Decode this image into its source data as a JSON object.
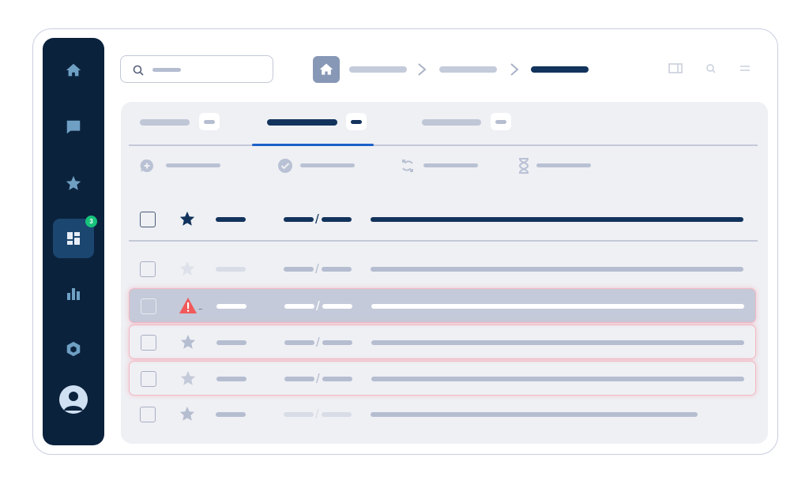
{
  "colors": {
    "sidebar_bg": "#0b223d",
    "nav_active_bg": "#1b4670",
    "nav_icon": "#6fa0c4",
    "badge": "#17c37b",
    "accent_tab": "#1b60c9",
    "dark_text": "#12335c",
    "muted_bar": "#b5bdd0",
    "warning_red": "#f1595a",
    "flag_border": "#f3b8c3"
  },
  "sidebar": {
    "items": [
      {
        "icon": "home-icon",
        "active": false
      },
      {
        "icon": "chat-icon",
        "active": false
      },
      {
        "icon": "star-icon",
        "active": false
      },
      {
        "icon": "dashboard-icon",
        "active": true,
        "badge": "3"
      },
      {
        "icon": "bar-chart-icon",
        "active": false
      },
      {
        "icon": "hexagon-icon",
        "active": false
      }
    ],
    "avatar_icon": "user-avatar-icon"
  },
  "search": {
    "placeholder": "",
    "icon": "search-icon"
  },
  "breadcrumb": {
    "home_icon": "home-icon",
    "items": [
      {
        "label": "",
        "current": false
      },
      {
        "label": "",
        "current": false
      },
      {
        "label": "",
        "current": true
      }
    ]
  },
  "toolbar": {
    "icons": [
      "panel-toggle-icon",
      "search-icon",
      "menu-icon"
    ]
  },
  "tabs": [
    {
      "label": "",
      "count": "",
      "active": false
    },
    {
      "label": "",
      "count": "",
      "active": true
    },
    {
      "label": "",
      "count": "",
      "active": false
    }
  ],
  "filters": [
    {
      "icon": "add-comment-icon",
      "label": ""
    },
    {
      "icon": "check-circle-icon",
      "label": ""
    },
    {
      "icon": "sync-icon",
      "label": ""
    },
    {
      "icon": "hourglass-icon",
      "label": ""
    }
  ],
  "table": {
    "header": {
      "col1": "",
      "col2a": "",
      "col2b": "",
      "col3": ""
    },
    "rows": [
      {
        "starred": false,
        "flagged": false,
        "selected": false,
        "warning": false
      },
      {
        "starred": false,
        "flagged": true,
        "selected": true,
        "warning": true
      },
      {
        "starred": false,
        "flagged": true,
        "selected": false,
        "warning": false
      },
      {
        "starred": false,
        "flagged": true,
        "selected": false,
        "warning": false
      },
      {
        "starred": false,
        "flagged": false,
        "selected": false,
        "warning": false
      }
    ]
  }
}
